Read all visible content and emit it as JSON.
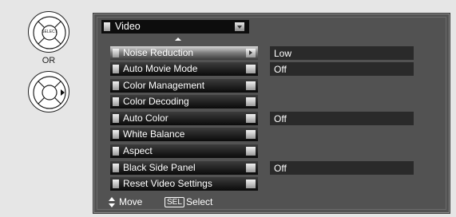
{
  "remote": {
    "select_key_text": "SELECT",
    "or_label": "OR"
  },
  "menu": {
    "title": "Video",
    "items": [
      {
        "label": "Noise Reduction",
        "value": "Low"
      },
      {
        "label": "Auto Movie Mode",
        "value": "Off"
      },
      {
        "label": "Color Management",
        "value": ""
      },
      {
        "label": "Color Decoding",
        "value": ""
      },
      {
        "label": "Auto Color",
        "value": "Off"
      },
      {
        "label": "White Balance",
        "value": ""
      },
      {
        "label": "Aspect",
        "value": ""
      },
      {
        "label": "Black Side Panel",
        "value": "Off"
      },
      {
        "label": "Reset Video Settings",
        "value": ""
      }
    ],
    "selected_index": 0
  },
  "footer": {
    "move_label": "Move",
    "sel_key": "SEL",
    "select_label": "Select"
  },
  "colors": {
    "panel": "#525252",
    "value_box": "#2a2a2a",
    "item_bar": "#0a0a0a",
    "selected_bar": "#9a9a9a"
  }
}
